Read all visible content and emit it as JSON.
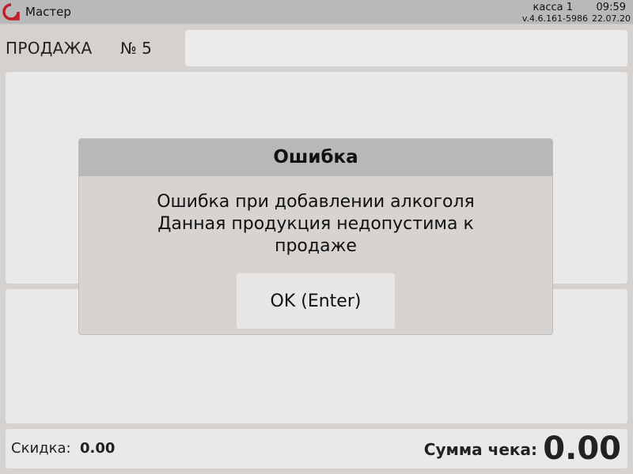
{
  "topbar": {
    "logo_icon": "app-logo-icon",
    "app_name": "Мастер",
    "cashbox": "касса 1",
    "time": "09:59",
    "version": "v.4.6.161-5986",
    "date": "22.07.20"
  },
  "sale": {
    "title": "ПРОДАЖА",
    "number": "№ 5",
    "search_value": ""
  },
  "bottom": {
    "discount_label": "Скидка:",
    "discount_value": "0.00",
    "total_label": "Сумма чека:",
    "total_value": "0.00"
  },
  "dialog": {
    "title": "Ошибка",
    "message_lines": [
      "Ошибка при добавлении алкоголя",
      "Данная продукция недопустима к",
      "продаже"
    ],
    "ok_label": "OK (Enter)"
  },
  "colors": {
    "background": "#d5d1ce",
    "topbar": "#b9b9b9",
    "panel": "#e9e9e9",
    "dialog_header": "#b8b8b8",
    "dialog_body": "#d6d3d0",
    "logo": "#c0202a"
  }
}
